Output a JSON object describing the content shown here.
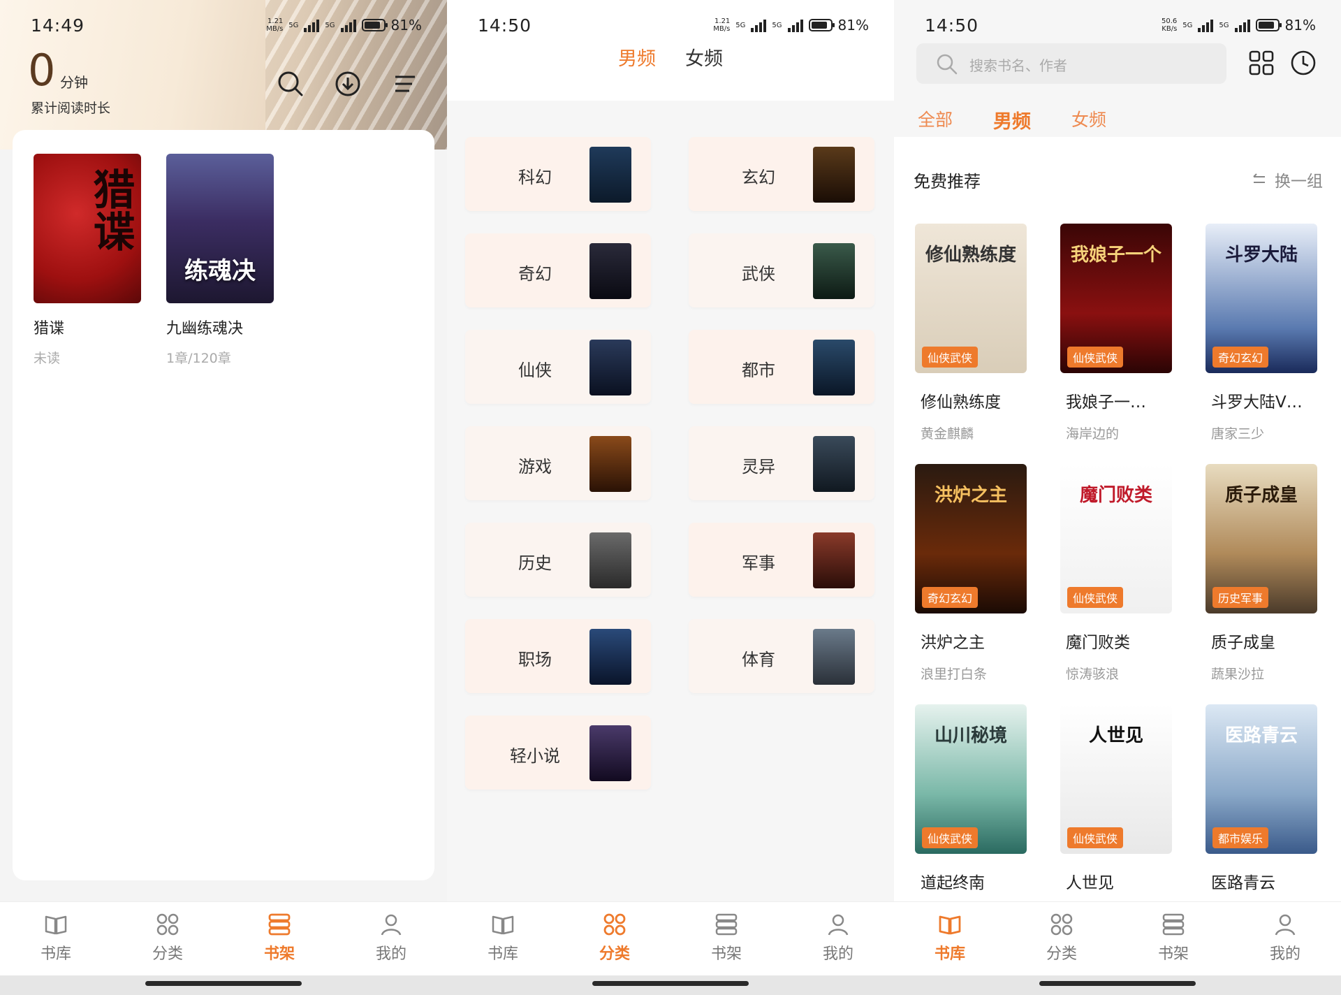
{
  "status": [
    {
      "time": "14:49",
      "speed_top": "1.21",
      "speed_unit": "MB/s",
      "net1": "5G",
      "net2": "5G",
      "battery": "81%"
    },
    {
      "time": "14:50",
      "speed_top": "1.21",
      "speed_unit": "MB/s",
      "net1": "5G",
      "net2": "5G",
      "battery": "81%"
    },
    {
      "time": "14:50",
      "speed_top": "50.6",
      "speed_unit": "KB/s",
      "net1": "5G",
      "net2": "5G",
      "battery": "81%"
    }
  ],
  "shelf": {
    "reading_minutes": "0",
    "reading_unit": "分钟",
    "reading_label": "累计阅读时长",
    "books": [
      {
        "title": "猎谍",
        "progress": "未读",
        "cover_text": "猎谍"
      },
      {
        "title": "九幽练魂决",
        "progress": "1章/120章",
        "cover_text": "练魂决"
      }
    ]
  },
  "category": {
    "gender_tabs": [
      "男频",
      "女频"
    ],
    "items": [
      "科幻",
      "玄幻",
      "奇幻",
      "武侠",
      "仙侠",
      "都市",
      "游戏",
      "灵异",
      "历史",
      "军事",
      "职场",
      "体育",
      "轻小说"
    ]
  },
  "library": {
    "search_placeholder": "搜索书名、作者",
    "tabs": [
      "全部",
      "男频",
      "女频"
    ],
    "section_title": "免费推荐",
    "refresh_label": "换一组",
    "books": [
      {
        "title": "修仙熟练度",
        "author": "黄金麒麟",
        "tag": "仙侠武侠",
        "cover_text": "修仙熟练度"
      },
      {
        "title": "我娘子一…",
        "author": "海岸边的",
        "tag": "仙侠武侠",
        "cover_text": "我娘子一个"
      },
      {
        "title": "斗罗大陆V…",
        "author": "唐家三少",
        "tag": "奇幻玄幻",
        "cover_text": "斗罗大陆"
      },
      {
        "title": "洪炉之主",
        "author": "浪里打白条",
        "tag": "奇幻玄幻",
        "cover_text": "洪炉之主"
      },
      {
        "title": "魔门败类",
        "author": "惊涛骇浪",
        "tag": "仙侠武侠",
        "cover_text": "魔门败类"
      },
      {
        "title": "质子成皇",
        "author": "蔬果沙拉",
        "tag": "历史军事",
        "cover_text": "质子成皇"
      },
      {
        "title": "道起终南",
        "author": "",
        "tag": "仙侠武侠",
        "cover_text": "山川秘境"
      },
      {
        "title": "人世见",
        "author": "",
        "tag": "仙侠武侠",
        "cover_text": "人世见"
      },
      {
        "title": "医路青云",
        "author": "",
        "tag": "都市娱乐",
        "cover_text": "医路青云"
      }
    ]
  },
  "tabbar": [
    "书库",
    "分类",
    "书架",
    "我的"
  ],
  "colors": {
    "accent": "#ee7a2c",
    "text": "#222222",
    "muted": "#999999"
  }
}
